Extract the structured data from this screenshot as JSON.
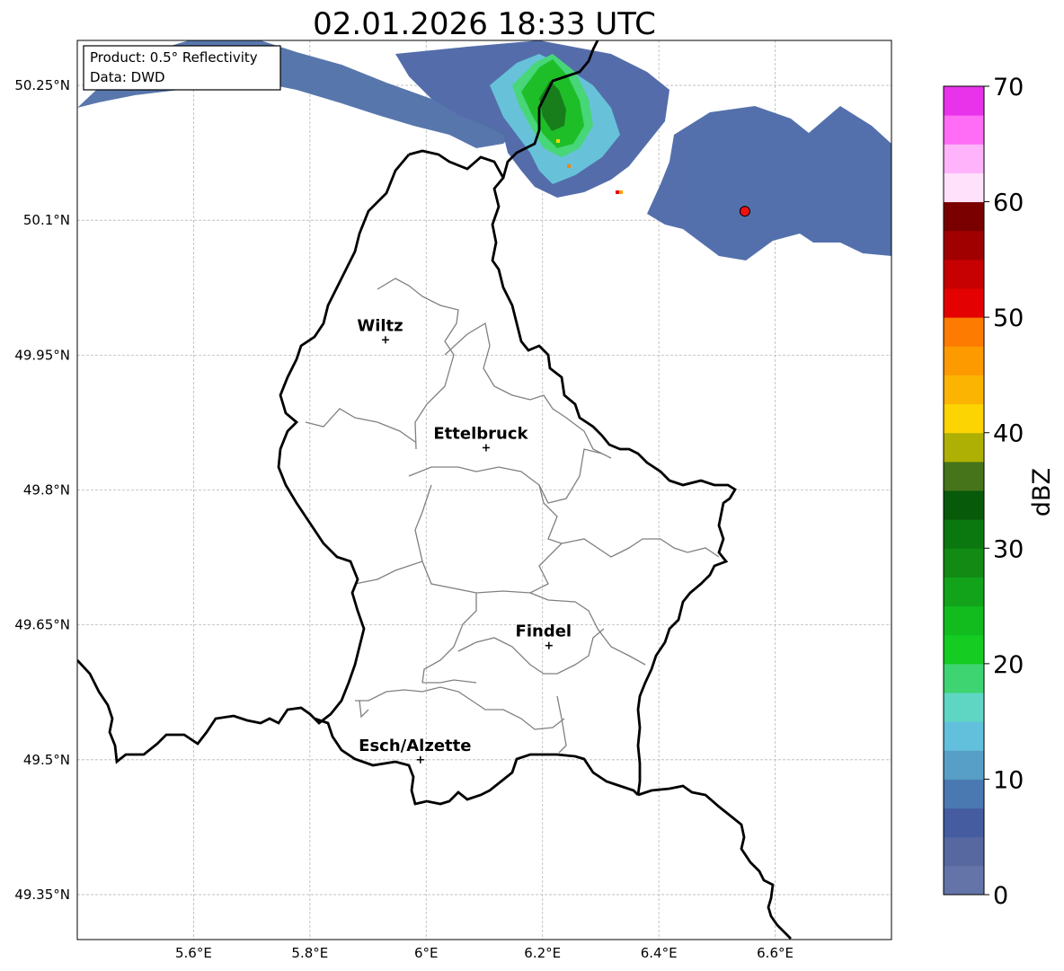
{
  "title": "02.01.2026 18:33 UTC",
  "info_box": {
    "product": "Product: 0.5° Reflectivity",
    "data": "Data: DWD"
  },
  "map": {
    "lon_range": [
      5.4,
      6.8
    ],
    "lat_range": [
      49.3,
      50.3
    ],
    "grid": true,
    "x_ticks": [
      {
        "value": 5.6,
        "label": "5.6°E"
      },
      {
        "value": 5.8,
        "label": "5.8°E"
      },
      {
        "value": 6.0,
        "label": "6°E"
      },
      {
        "value": 6.2,
        "label": "6.2°E"
      },
      {
        "value": 6.4,
        "label": "6.4°E"
      },
      {
        "value": 6.6,
        "label": "6.6°E"
      }
    ],
    "y_ticks": [
      {
        "value": 50.25,
        "label": "50.25°N"
      },
      {
        "value": 50.1,
        "label": "50.1°N"
      },
      {
        "value": 49.95,
        "label": "49.95°N"
      },
      {
        "value": 49.8,
        "label": "49.8°N"
      },
      {
        "value": 49.65,
        "label": "49.65°N"
      },
      {
        "value": 49.5,
        "label": "49.5°N"
      },
      {
        "value": 49.35,
        "label": "49.35°N"
      }
    ],
    "cities": [
      {
        "name": "Wiltz",
        "lon": 5.93,
        "lat": 49.967
      },
      {
        "name": "Ettelbruck",
        "lon": 6.103,
        "lat": 49.847
      },
      {
        "name": "Findel",
        "lon": 6.211,
        "lat": 49.627
      },
      {
        "name": "Esch/Alzette",
        "lon": 5.99,
        "lat": 49.5
      }
    ],
    "radar_site": {
      "lon": 6.548,
      "lat": 50.11,
      "color": "#ee1111"
    },
    "border_colors": {
      "country": "#000000",
      "district": "#808080"
    }
  },
  "colorbar": {
    "label": "dBZ",
    "min": 0,
    "max": 70,
    "step": 2.5,
    "ticks": [
      "0",
      "10",
      "20",
      "30",
      "40",
      "50",
      "60",
      "70"
    ],
    "colors": [
      "#6474a8",
      "#56689f",
      "#455da0",
      "#4a79b1",
      "#579fc7",
      "#62c0dc",
      "#5fd6c4",
      "#3ed471",
      "#14cc22",
      "#12bb1e",
      "#12a31a",
      "#128a14",
      "#0b780f",
      "#075a09",
      "#46741a",
      "#aeb004",
      "#fbd401",
      "#fcb402",
      "#fd9a00",
      "#fd7b01",
      "#e40101",
      "#c70101",
      "#a10000",
      "#7a0000",
      "#ffe1fc",
      "#ffb3fb",
      "#ff6cf5",
      "#e833ea"
    ]
  }
}
